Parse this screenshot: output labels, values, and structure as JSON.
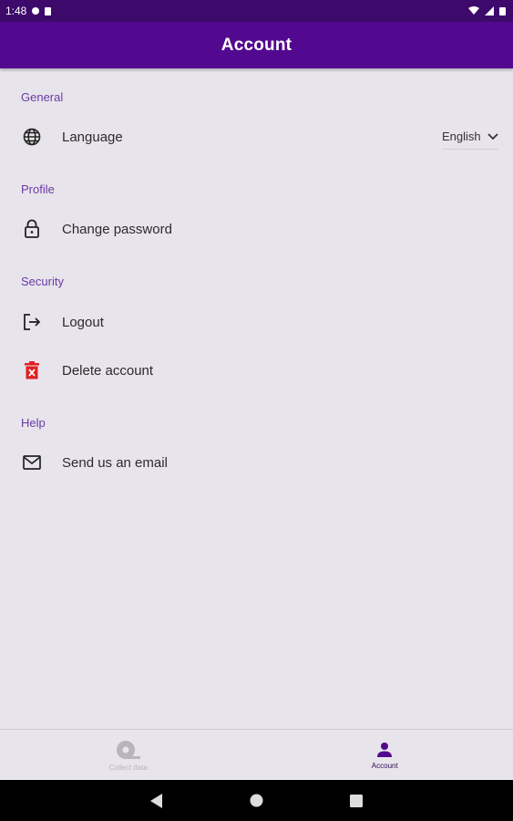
{
  "status_bar": {
    "time": "1:48"
  },
  "app_bar": {
    "title": "Account"
  },
  "sections": {
    "general": {
      "header": "General",
      "language_label": "Language",
      "language_value": "English"
    },
    "profile": {
      "header": "Profile",
      "change_password_label": "Change password"
    },
    "security": {
      "header": "Security",
      "logout_label": "Logout",
      "delete_account_label": "Delete account"
    },
    "help": {
      "header": "Help",
      "email_label": "Send us an email"
    }
  },
  "bottom_nav": {
    "collect_data_label": "Collect data",
    "account_label": "Account"
  },
  "colors": {
    "app_bar": "#53098f",
    "status_bar": "#3d0a6b",
    "accent": "#6a3aa3",
    "delete_red": "#e02020"
  },
  "icons": {
    "language": "globe-icon",
    "change_password": "lock-icon",
    "logout": "logout-icon",
    "delete_account": "trash-icon",
    "email": "mail-icon",
    "collect_data": "camera-icon",
    "account": "person-icon"
  }
}
